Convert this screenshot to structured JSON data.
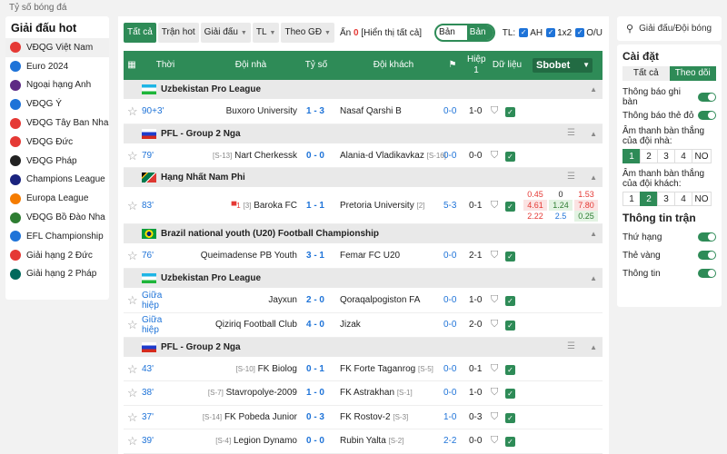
{
  "breadcrumb": "Tỷ số bóng đá",
  "left": {
    "title": "Giải đấu hot",
    "items": [
      {
        "label": "VĐQG Việt Nam",
        "color": "#e53935"
      },
      {
        "label": "Euro 2024",
        "color": "#1e73d8"
      },
      {
        "label": "Ngoại hạng Anh",
        "color": "#5e2a84"
      },
      {
        "label": "VĐQG Ý",
        "color": "#1e73d8"
      },
      {
        "label": "VĐQG Tây Ban Nha",
        "color": "#e53935"
      },
      {
        "label": "VĐQG Đức",
        "color": "#e53935"
      },
      {
        "label": "VĐQG Pháp",
        "color": "#222"
      },
      {
        "label": "Champions League",
        "color": "#1a237e"
      },
      {
        "label": "Europa League",
        "color": "#f57c00"
      },
      {
        "label": "VĐQG Bồ Đào Nha",
        "color": "#2e7d32"
      },
      {
        "label": "EFL Championship",
        "color": "#1e73d8"
      },
      {
        "label": "Giải hạng 2 Đức",
        "color": "#e53935"
      },
      {
        "label": "Giải hạng 2 Pháp",
        "color": "#00695c"
      }
    ]
  },
  "toolbar": {
    "tab_all": "Tất cả",
    "tab_hot": "Trận hot",
    "tab_league": "Giải đấu",
    "tab_tl": "TL",
    "tab_sort": "Theo GĐ",
    "hidden_prefix": "Ẩn",
    "hidden_count": "0",
    "show_all": "[Hiển thị tất cả]",
    "new": "Bản mới",
    "old": "Bản cũ",
    "tl_label": "TL:",
    "ah": "AH",
    "x12": "1x2",
    "ou": "O/U"
  },
  "thead": {
    "time": "Thời gian",
    "home": "Đội nhà",
    "score": "Tỷ số",
    "away": "Đội khách",
    "ht": "Hiệp 1",
    "data": "Dữ liệu",
    "bookmaker": "Sbobet"
  },
  "leagues": [
    {
      "name": "Uzbekistan Pro League",
      "flag": "uz",
      "matches": [
        {
          "min": "90+3'",
          "home": "Buxoro University",
          "score": "1 - 3",
          "away": "Nasaf Qarshi B",
          "ht_corner": "0-0",
          "ht": "1-0"
        }
      ]
    },
    {
      "name": "PFL - Group 2 Nga",
      "flag": "ru",
      "matches": [
        {
          "min": "79'",
          "home": "Nart Cherkessk",
          "home_rank": "[S-13]",
          "score": "0 - 0",
          "away": "Alania-d Vladikavkaz",
          "away_rank": "[S-16]",
          "ht_corner": "0-0",
          "ht": "0-0"
        }
      ]
    },
    {
      "name": "Hạng Nhất Nam Phi",
      "flag": "za",
      "matches": [
        {
          "min": "83'",
          "home": "Baroka FC",
          "home_rank": "[3]",
          "home_red": "1",
          "score": "1 - 1",
          "away": "Pretoria University",
          "away_rank": "[2]",
          "ht_corner": "5-3",
          "ht": "0-1",
          "odds": [
            [
              "0.45",
              "0",
              "1.53"
            ],
            [
              "4.61",
              "1.24",
              "7.80"
            ],
            [
              "2.22",
              "2.5",
              "0.25"
            ]
          ]
        }
      ]
    },
    {
      "name": "Brazil national youth (U20) Football Championship",
      "flag": "br",
      "matches": [
        {
          "min": "76'",
          "home": "Queimadense PB Youth",
          "score": "3 - 1",
          "away": "Femar FC U20",
          "ht_corner": "0-0",
          "ht": "2-1"
        }
      ]
    },
    {
      "name": "Uzbekistan Pro League",
      "flag": "uz",
      "matches": [
        {
          "min": "Giữa hiệp",
          "home": "Jayxun",
          "score": "2 - 0",
          "away": "Qoraqalpogiston FA",
          "ht_corner": "0-0",
          "ht": "1-0"
        },
        {
          "min": "Giữa hiệp",
          "home": "Qiziriq Football Club",
          "score": "4 - 0",
          "away": "Jizak",
          "ht_corner": "0-0",
          "ht": "2-0"
        }
      ]
    },
    {
      "name": "PFL - Group 2 Nga",
      "flag": "ru",
      "matches": [
        {
          "min": "43'",
          "home": "FK Biolog",
          "home_rank": "[S-10]",
          "score": "0 - 1",
          "away": "FK Forte Taganrog",
          "away_rank": "[S-5]",
          "ht_corner": "0-0",
          "ht": "0-1"
        },
        {
          "min": "38'",
          "home": "Stavropolye-2009",
          "home_rank": "[S-7]",
          "score": "1 - 0",
          "away": "FK Astrakhan",
          "away_rank": "[S-1]",
          "ht_corner": "0-0",
          "ht": "1-0"
        },
        {
          "min": "37'",
          "home": "FK Pobeda Junior",
          "home_rank": "[S-14]",
          "score": "0 - 3",
          "away": "FK Rostov-2",
          "away_rank": "[S-3]",
          "ht_corner": "1-0",
          "ht": "0-3"
        },
        {
          "min": "39'",
          "home": "Legion Dynamo",
          "home_rank": "[S-4]",
          "score": "0 - 0",
          "away": "Rubin Yalta",
          "away_rank": "[S-2]",
          "ht_corner": "2-2",
          "ht": "0-0"
        }
      ]
    }
  ],
  "right": {
    "search": "Giải đấu/Đội bóng",
    "settings": "Cài đặt",
    "seg_all": "Tất cả",
    "seg_follow": "Theo dõi",
    "notify_goal": "Thông báo ghi bàn",
    "notify_card": "Thông báo thẻ đỏ",
    "sound_home": "Âm thanh bàn thắng của đội nhà:",
    "sound_away": "Âm thanh bàn thắng của đội khách:",
    "nums": [
      "1",
      "2",
      "3",
      "4",
      "NO"
    ],
    "match_info": "Thông tin trận",
    "rank": "Thứ hạng",
    "yellow": "Thẻ vàng",
    "info": "Thông tin"
  }
}
